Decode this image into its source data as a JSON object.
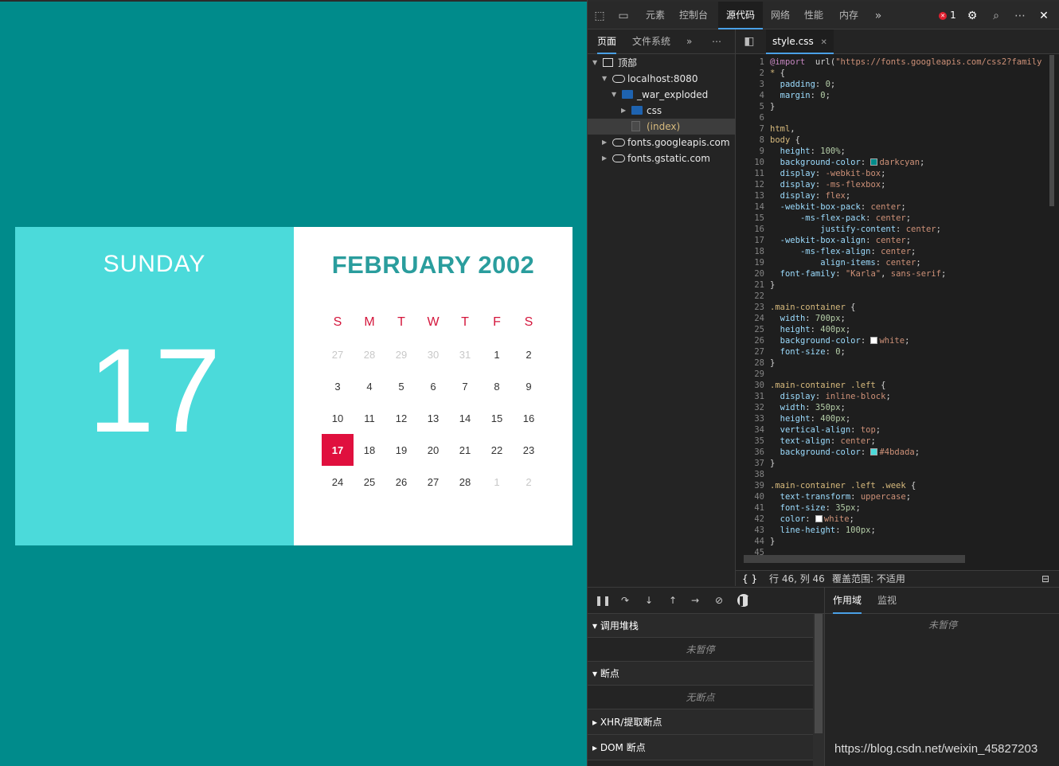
{
  "calendar": {
    "weekday": "SUNDAY",
    "day": "17",
    "month_title": "FEBRUARY 2002",
    "day_headers": [
      "S",
      "M",
      "T",
      "W",
      "T",
      "F",
      "S"
    ],
    "weeks": [
      [
        "27",
        "28",
        "29",
        "30",
        "31",
        "1",
        "2"
      ],
      [
        "3",
        "4",
        "5",
        "6",
        "7",
        "8",
        "9"
      ],
      [
        "10",
        "11",
        "12",
        "13",
        "14",
        "15",
        "16"
      ],
      [
        "17",
        "18",
        "19",
        "20",
        "21",
        "22",
        "23"
      ],
      [
        "24",
        "25",
        "26",
        "27",
        "28",
        "1",
        "2"
      ]
    ],
    "today": "17",
    "colors": {
      "page_bg": "#008b8b",
      "left_panel": "#4bdada",
      "title": "#2a9d9d",
      "day_header": "#d4163c",
      "today_bg": "#e0103e"
    }
  },
  "devtools": {
    "tabs": [
      "元素",
      "控制台",
      "源代码",
      "网络",
      "性能",
      "内存"
    ],
    "active_tab": "源代码",
    "error_count": "1",
    "more_tabs_icon": "chevrons-right-icon",
    "nav_tabs": [
      "页面",
      "文件系统"
    ],
    "tree": [
      {
        "label": "顶部",
        "icon": "frame-icon",
        "level": 0,
        "expanded": true
      },
      {
        "label": "localhost:8080",
        "icon": "cloud-icon",
        "level": 1,
        "expanded": true
      },
      {
        "label": "_war_exploded",
        "icon": "folder-icon",
        "level": 2,
        "expanded": true
      },
      {
        "label": "css",
        "icon": "folder-icon",
        "level": 3,
        "expanded": false
      },
      {
        "label": "(index)",
        "icon": "file-icon",
        "level": 3,
        "selected": true
      },
      {
        "label": "fonts.googleapis.com",
        "icon": "cloud-icon",
        "level": 1,
        "expanded": false
      },
      {
        "label": "fonts.gstatic.com",
        "icon": "cloud-icon",
        "level": 1,
        "expanded": false
      }
    ],
    "editor_tab": "style.css",
    "status": {
      "position": "行 46, 列 46",
      "coverage": "覆盖范围: 不适用"
    },
    "debug_sections": [
      {
        "title": "调用堆栈",
        "expanded": true,
        "body": "未暂停"
      },
      {
        "title": "断点",
        "expanded": true,
        "body": "无断点"
      },
      {
        "title": "XHR/提取断点",
        "expanded": false
      },
      {
        "title": "DOM 断点",
        "expanded": false
      }
    ],
    "scope_tabs": [
      "作用域",
      "监视"
    ],
    "scope_empty": "未暂停"
  },
  "code_lines": [
    [
      [
        "kw",
        "@import"
      ],
      [
        "",
        "  url("
      ],
      [
        "val",
        "\"https://fonts.googleapis.com/css2?family"
      ]
    ],
    [
      [
        "sel",
        "* "
      ],
      [
        "",
        "{"
      ]
    ],
    [
      [
        "",
        "  "
      ],
      [
        "prop",
        "padding"
      ],
      [
        "",
        ": "
      ],
      [
        "num",
        "0"
      ],
      [
        "",
        ";"
      ]
    ],
    [
      [
        "",
        "  "
      ],
      [
        "prop",
        "margin"
      ],
      [
        "",
        ": "
      ],
      [
        "num",
        "0"
      ],
      [
        "",
        ";"
      ]
    ],
    [
      [
        "",
        "}"
      ]
    ],
    [],
    [
      [
        "sel",
        "html"
      ],
      [
        "",
        ","
      ]
    ],
    [
      [
        "sel",
        "body "
      ],
      [
        "",
        "{"
      ]
    ],
    [
      [
        "",
        "  "
      ],
      [
        "prop",
        "height"
      ],
      [
        "",
        ": "
      ],
      [
        "num",
        "100%"
      ],
      [
        "",
        ";"
      ]
    ],
    [
      [
        "",
        "  "
      ],
      [
        "prop",
        "background-color"
      ],
      [
        "",
        ": "
      ],
      [
        "swatch",
        "#008b8b"
      ],
      [
        "val",
        "darkcyan"
      ],
      [
        "",
        ";"
      ]
    ],
    [
      [
        "",
        "  "
      ],
      [
        "prop",
        "display"
      ],
      [
        "",
        ": "
      ],
      [
        "val",
        "-webkit-box"
      ],
      [
        "",
        ";"
      ]
    ],
    [
      [
        "",
        "  "
      ],
      [
        "prop",
        "display"
      ],
      [
        "",
        ": "
      ],
      [
        "val",
        "-ms-flexbox"
      ],
      [
        "",
        ";"
      ]
    ],
    [
      [
        "",
        "  "
      ],
      [
        "prop",
        "display"
      ],
      [
        "",
        ": "
      ],
      [
        "val",
        "flex"
      ],
      [
        "",
        ";"
      ]
    ],
    [
      [
        "",
        "  "
      ],
      [
        "prop",
        "-webkit-box-pack"
      ],
      [
        "",
        ": "
      ],
      [
        "val",
        "center"
      ],
      [
        "",
        ";"
      ]
    ],
    [
      [
        "",
        "      "
      ],
      [
        "prop",
        "-ms-flex-pack"
      ],
      [
        "",
        ": "
      ],
      [
        "val",
        "center"
      ],
      [
        "",
        ";"
      ]
    ],
    [
      [
        "",
        "          "
      ],
      [
        "prop",
        "justify-content"
      ],
      [
        "",
        ": "
      ],
      [
        "val",
        "center"
      ],
      [
        "",
        ";"
      ]
    ],
    [
      [
        "",
        "  "
      ],
      [
        "prop",
        "-webkit-box-align"
      ],
      [
        "",
        ": "
      ],
      [
        "val",
        "center"
      ],
      [
        "",
        ";"
      ]
    ],
    [
      [
        "",
        "      "
      ],
      [
        "prop",
        "-ms-flex-align"
      ],
      [
        "",
        ": "
      ],
      [
        "val",
        "center"
      ],
      [
        "",
        ";"
      ]
    ],
    [
      [
        "",
        "          "
      ],
      [
        "prop",
        "align-items"
      ],
      [
        "",
        ": "
      ],
      [
        "val",
        "center"
      ],
      [
        "",
        ";"
      ]
    ],
    [
      [
        "",
        "  "
      ],
      [
        "prop",
        "font-family"
      ],
      [
        "",
        ": "
      ],
      [
        "val",
        "\"Karla\""
      ],
      [
        "",
        ", "
      ],
      [
        "val",
        "sans-serif"
      ],
      [
        "",
        ";"
      ]
    ],
    [
      [
        "",
        "}"
      ]
    ],
    [],
    [
      [
        "sel",
        ".main-container "
      ],
      [
        "",
        "{"
      ]
    ],
    [
      [
        "",
        "  "
      ],
      [
        "prop",
        "width"
      ],
      [
        "",
        ": "
      ],
      [
        "num",
        "700px"
      ],
      [
        "",
        ";"
      ]
    ],
    [
      [
        "",
        "  "
      ],
      [
        "prop",
        "height"
      ],
      [
        "",
        ": "
      ],
      [
        "num",
        "400px"
      ],
      [
        "",
        ";"
      ]
    ],
    [
      [
        "",
        "  "
      ],
      [
        "prop",
        "background-color"
      ],
      [
        "",
        ": "
      ],
      [
        "swatch",
        "#ffffff"
      ],
      [
        "val",
        "white"
      ],
      [
        "",
        ";"
      ]
    ],
    [
      [
        "",
        "  "
      ],
      [
        "prop",
        "font-size"
      ],
      [
        "",
        ": "
      ],
      [
        "num",
        "0"
      ],
      [
        "",
        ";"
      ]
    ],
    [
      [
        "",
        "}"
      ]
    ],
    [],
    [
      [
        "sel",
        ".main-container .left "
      ],
      [
        "",
        "{"
      ]
    ],
    [
      [
        "",
        "  "
      ],
      [
        "prop",
        "display"
      ],
      [
        "",
        ": "
      ],
      [
        "val",
        "inline-block"
      ],
      [
        "",
        ";"
      ]
    ],
    [
      [
        "",
        "  "
      ],
      [
        "prop",
        "width"
      ],
      [
        "",
        ": "
      ],
      [
        "num",
        "350px"
      ],
      [
        "",
        ";"
      ]
    ],
    [
      [
        "",
        "  "
      ],
      [
        "prop",
        "height"
      ],
      [
        "",
        ": "
      ],
      [
        "num",
        "400px"
      ],
      [
        "",
        ";"
      ]
    ],
    [
      [
        "",
        "  "
      ],
      [
        "prop",
        "vertical-align"
      ],
      [
        "",
        ": "
      ],
      [
        "val",
        "top"
      ],
      [
        "",
        ";"
      ]
    ],
    [
      [
        "",
        "  "
      ],
      [
        "prop",
        "text-align"
      ],
      [
        "",
        ": "
      ],
      [
        "val",
        "center"
      ],
      [
        "",
        ";"
      ]
    ],
    [
      [
        "",
        "  "
      ],
      [
        "prop",
        "background-color"
      ],
      [
        "",
        ": "
      ],
      [
        "swatch",
        "#4bdada"
      ],
      [
        "val",
        "#4bdada"
      ],
      [
        "",
        ";"
      ]
    ],
    [
      [
        "",
        "}"
      ]
    ],
    [],
    [
      [
        "sel",
        ".main-container .left .week "
      ],
      [
        "",
        "{"
      ]
    ],
    [
      [
        "",
        "  "
      ],
      [
        "prop",
        "text-transform"
      ],
      [
        "",
        ": "
      ],
      [
        "val",
        "uppercase"
      ],
      [
        "",
        ";"
      ]
    ],
    [
      [
        "",
        "  "
      ],
      [
        "prop",
        "font-size"
      ],
      [
        "",
        ": "
      ],
      [
        "num",
        "35px"
      ],
      [
        "",
        ";"
      ]
    ],
    [
      [
        "",
        "  "
      ],
      [
        "prop",
        "color"
      ],
      [
        "",
        ": "
      ],
      [
        "swatch",
        "#ffffff"
      ],
      [
        "val",
        "white"
      ],
      [
        "",
        ";"
      ]
    ],
    [
      [
        "",
        "  "
      ],
      [
        "prop",
        "line-height"
      ],
      [
        "",
        ": "
      ],
      [
        "num",
        "100px"
      ],
      [
        "",
        ";"
      ]
    ],
    [
      [
        "",
        "}"
      ]
    ],
    [],
    []
  ],
  "watermark": "https://blog.csdn.net/weixin_45827203"
}
